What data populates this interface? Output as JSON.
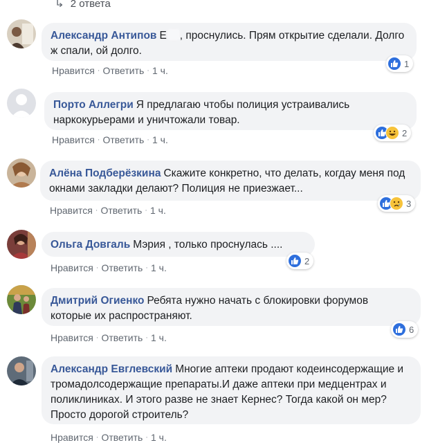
{
  "thread": {
    "replies_label": "2 ответа"
  },
  "actions": {
    "like": "Нравится",
    "reply": "Ответить",
    "separator": "·"
  },
  "comments": [
    {
      "author": "Александр Антипов",
      "text_before": "Е",
      "text_after": ", проснулись. Прям открытие сделали. Долго ж спали, ой долго.",
      "time": "1 ч.",
      "reaction_count": "1"
    },
    {
      "author": "Порто Аллегри",
      "text": "Я предлагаю чтобы полиция устраивались наркокурьерами и уничтожали товар.",
      "time": "1 ч.",
      "reaction_count": "2"
    },
    {
      "author": "Алёна Подберёзкина",
      "text": "Скажите конкретно, что делать, когдау меня под окнами закладки делают? Полиция не приезжает...",
      "time": "1 ч.",
      "reaction_count": "3"
    },
    {
      "author": "Ольга Довгаль",
      "text": "Мэрия , только проснулась ....",
      "time": "1 ч.",
      "reaction_count": "2"
    },
    {
      "author": "Дмитрий Огиенко",
      "text": "Ребята нужно начать с блокировки форумов которые их распространяют.",
      "time": "1 ч.",
      "reaction_count": "6"
    },
    {
      "author": "Александр Евглевский",
      "text": "Многие аптеки продают кодеинсодержащие и тромадолсодержащие препараты.И даже аптеки при медцентрах и поликлиниках. И этого разве не знает Кернес? Тогда какой он мер? Просто дорогой строитель?",
      "time": "1 ч."
    }
  ],
  "icons": {
    "like": "thumbs-up-icon",
    "laugh": "laugh-emoji-icon",
    "sad": "sad-emoji-icon",
    "reply_arrow": "reply-arrow-icon"
  },
  "colors": {
    "author": "#385898",
    "bubble": "#f2f3f5",
    "like_blue": "#2e6fdd",
    "emoji_yellow": "#f7c33a",
    "meta_gray": "#606770"
  }
}
